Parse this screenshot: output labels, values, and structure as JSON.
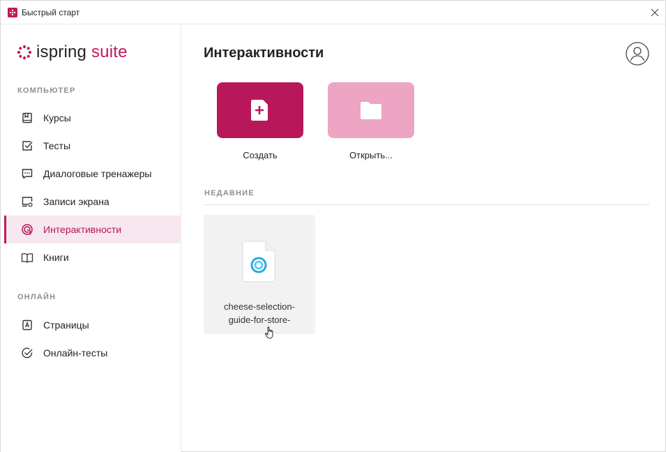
{
  "window": {
    "title": "Быстрый старт"
  },
  "logo": {
    "brand": "ispring",
    "product": "suite"
  },
  "sidebar": {
    "sections": [
      {
        "title": "КОМПЬЮТЕР"
      },
      {
        "title": "ОНЛАЙН"
      }
    ],
    "items": [
      {
        "label": "Курсы",
        "icon": "book-icon"
      },
      {
        "label": "Тесты",
        "icon": "checkbox-icon"
      },
      {
        "label": "Диалоговые тренажеры",
        "icon": "chat-icon"
      },
      {
        "label": "Записи экрана",
        "icon": "screen-record-icon"
      },
      {
        "label": "Интерактивности",
        "icon": "interaction-icon",
        "active": true
      },
      {
        "label": "Книги",
        "icon": "open-book-icon"
      },
      {
        "label": "Страницы",
        "icon": "page-icon"
      },
      {
        "label": "Онлайн-тесты",
        "icon": "check-circle-icon"
      }
    ]
  },
  "main": {
    "title": "Интерактивности",
    "actions": [
      {
        "label": "Создать",
        "icon": "new-file-icon",
        "color": "#b8175a"
      },
      {
        "label": "Открыть...",
        "icon": "folder-icon",
        "color": "#eea4c3"
      }
    ],
    "recent": {
      "title": "НЕДАВНИЕ",
      "items": [
        {
          "name_line1": "cheese-selection-",
          "name_line2": "guide-for-store-",
          "icon": "interaction-file-icon"
        }
      ]
    }
  },
  "colors": {
    "accent": "#c2185b",
    "active_bg": "#f7e7ee",
    "muted_text": "#8a8f98"
  }
}
